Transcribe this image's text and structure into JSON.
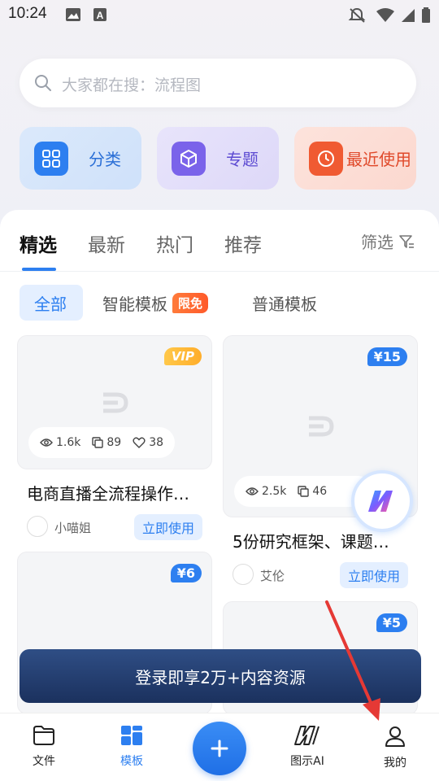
{
  "status_bar": {
    "time": "10:24"
  },
  "search": {
    "placeholder": "大家都在搜：流程图"
  },
  "quick_actions": [
    {
      "label": "分类",
      "icon": "grid-icon"
    },
    {
      "label": "专题",
      "icon": "cube-icon"
    },
    {
      "label": "最近使用",
      "icon": "clock-icon"
    }
  ],
  "tabs": [
    {
      "label": "精选",
      "active": true
    },
    {
      "label": "最新"
    },
    {
      "label": "热门"
    },
    {
      "label": "推荐"
    }
  ],
  "filter_label": "筛选",
  "subtabs": [
    {
      "label": "全部",
      "active": true
    },
    {
      "label": "智能模板",
      "badge": "限免"
    },
    {
      "label": "普通模板"
    }
  ],
  "cards": [
    {
      "tag": "VIP",
      "views": "1.6k",
      "copies": "89",
      "likes": "38",
      "title": "电商直播全流程操作…",
      "author": "小喵姐",
      "action": "立即使用"
    },
    {
      "tag": "¥15",
      "views": "2.5k",
      "copies": "46",
      "title": "5份研究框架、课题…",
      "author": "艾伦",
      "action": "立即使用"
    },
    {
      "tag": "¥6"
    },
    {
      "tag": "¥5"
    }
  ],
  "login_banner": "登录即享2万+内容资源",
  "bottom_nav": [
    {
      "label": "文件",
      "icon": "folder-icon"
    },
    {
      "label": "模板",
      "icon": "template-icon",
      "active": true
    },
    {
      "label": "图示AI",
      "icon": "ai-logo-icon"
    },
    {
      "label": "我的",
      "icon": "user-icon"
    }
  ],
  "colors": {
    "accent": "#2d7ff0",
    "orange": "#f05a32",
    "purple": "#7a63ea",
    "banner": "#1b315e"
  }
}
